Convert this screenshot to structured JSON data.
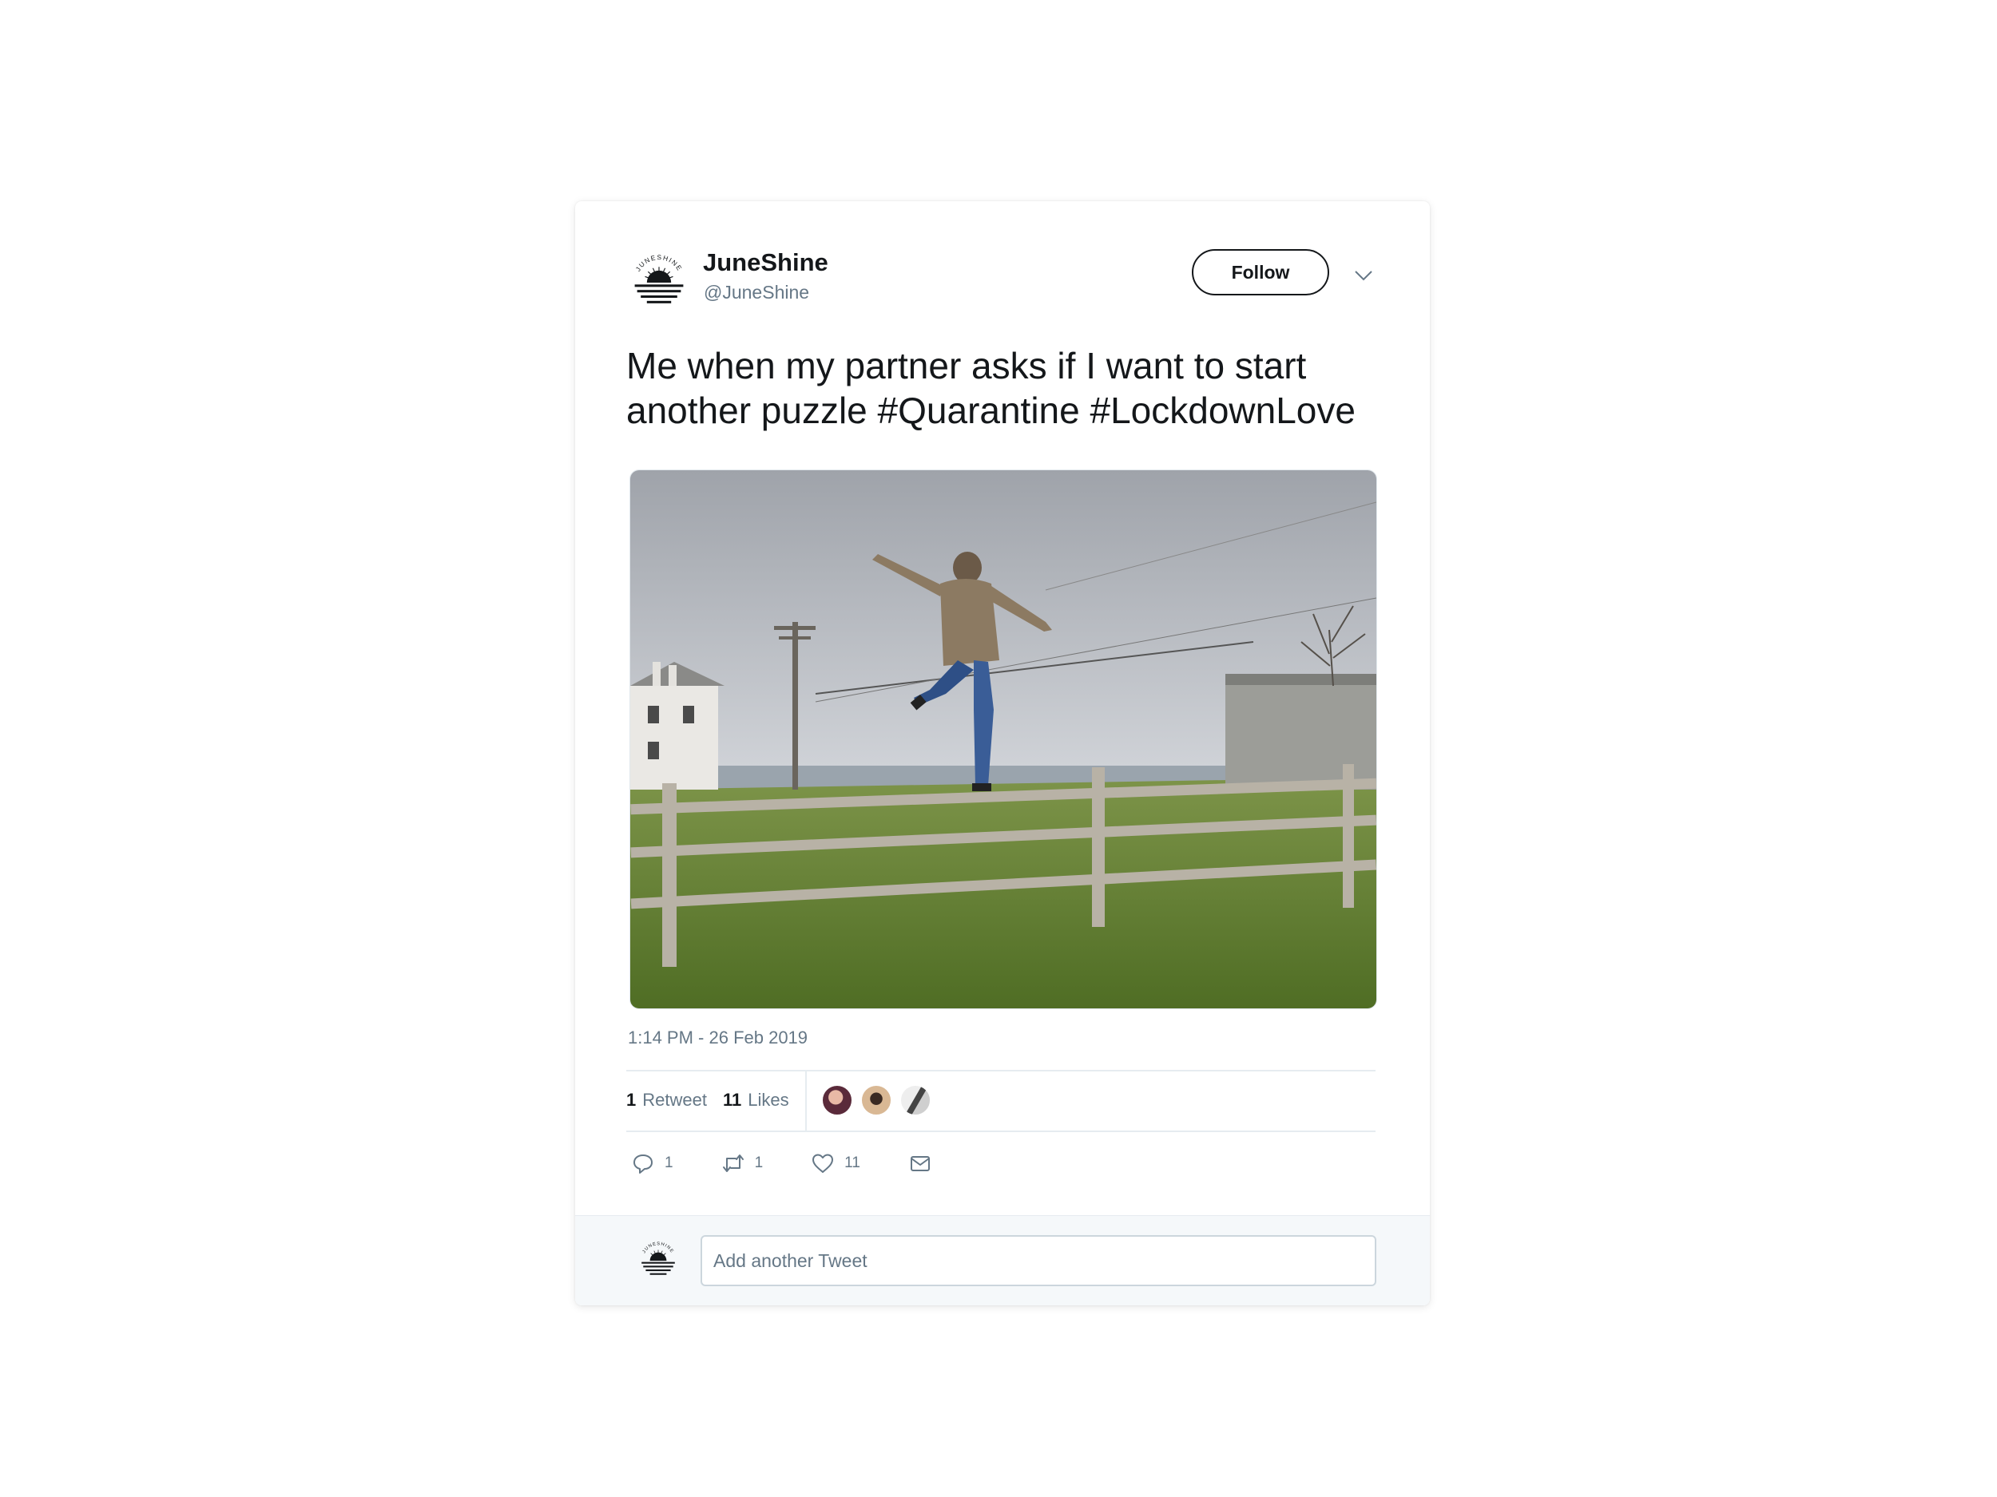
{
  "tweet": {
    "display_name": "JuneShine",
    "handle": "@JuneShine",
    "follow_label": "Follow",
    "text": "Me when my partner asks if I want to start another puzzle #Quarantine #LockdownLove",
    "timestamp": "1:14 PM - 26 Feb 2019"
  },
  "stats": {
    "retweets_count": "1",
    "retweets_label": "Retweet",
    "likes_count": "11",
    "likes_label": "Likes"
  },
  "actions": {
    "reply_count": "1",
    "retweet_count": "1",
    "like_count": "11"
  },
  "reply": {
    "placeholder": "Add another Tweet"
  },
  "logo": {
    "wordmark": "JUNESHINE"
  },
  "icons": {
    "avatar": "juneshine-logo-icon",
    "chevron": "chevron-down-icon",
    "reply": "reply-icon",
    "retweet": "retweet-icon",
    "like": "heart-icon",
    "message": "envelope-icon"
  },
  "colors": {
    "text_primary": "#14171a",
    "text_secondary": "#657786",
    "border": "#e6ecf0",
    "reply_bar_bg": "#f5f8fa"
  }
}
